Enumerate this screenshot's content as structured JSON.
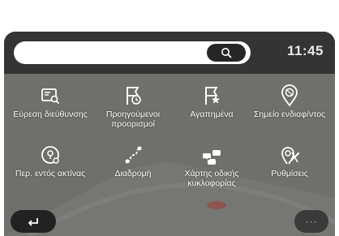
{
  "status": {
    "time": "11:45"
  },
  "search": {
    "value": "",
    "icon": "search-icon"
  },
  "menu": [
    {
      "label": "Εύρεση διεύθυνσης",
      "icon": "address-search-icon"
    },
    {
      "label": "Προηγούμενοι\nπροορισμοί",
      "icon": "previous-destinations-icon"
    },
    {
      "label": "Αγαπημένα",
      "icon": "favorites-flag-icon"
    },
    {
      "label": "Σημείο ενδιαφ/ντος",
      "icon": "point-of-interest-icon"
    },
    {
      "label": "Περ. εντός ακτίνας",
      "icon": "radius-area-icon"
    },
    {
      "label": "Διαδρομή",
      "icon": "route-icon"
    },
    {
      "label": "Χάρτης οδικής\nκυκλοφορίας",
      "icon": "traffic-map-icon"
    },
    {
      "label": "Ρυθμίσεις",
      "icon": "settings-icon"
    }
  ],
  "footer": {
    "back_icon": "back-arrow-icon",
    "more_label": "···"
  },
  "colors": {
    "topbar": "#343434",
    "panel": "#6f6f6c",
    "text": "#ffffff"
  }
}
